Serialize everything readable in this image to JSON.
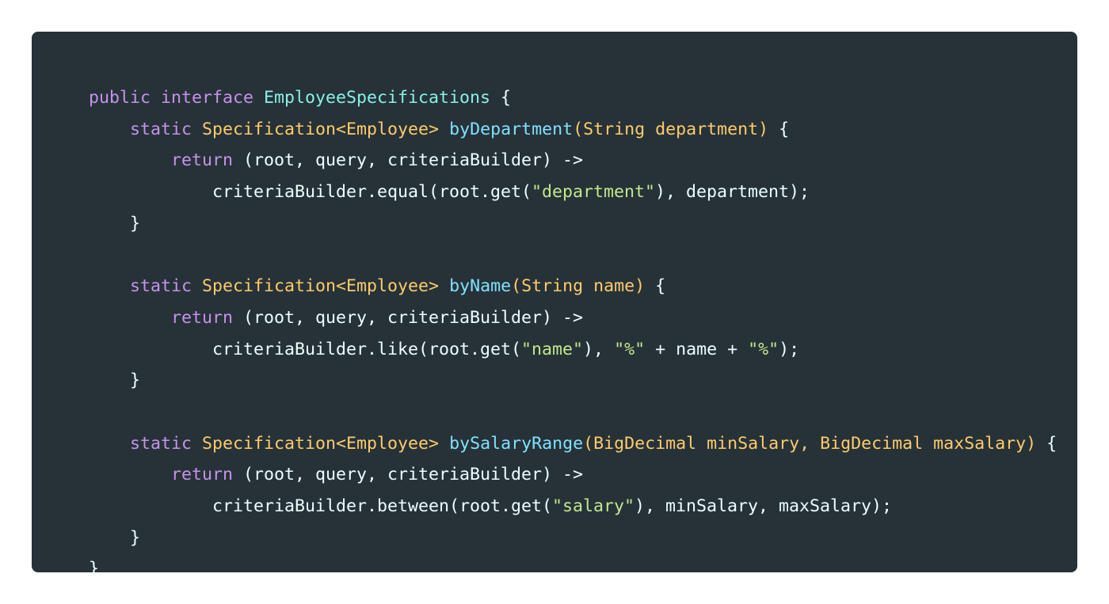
{
  "code": {
    "language": "java",
    "colors": {
      "background": "#263238",
      "keyword": "#c792ea",
      "type": "#ffcb6b",
      "function": "#82e0ff",
      "string": "#c3e88d",
      "plain": "#eeffff"
    },
    "lines": [
      [
        {
          "k": "keyword",
          "t": "public interface"
        },
        {
          "k": "plain",
          "t": " "
        },
        {
          "k": "iface",
          "t": "EmployeeSpecifications"
        },
        {
          "k": "plain",
          "t": " {"
        }
      ],
      [
        {
          "k": "plain",
          "t": "    "
        },
        {
          "k": "keyword",
          "t": "static"
        },
        {
          "k": "plain",
          "t": " "
        },
        {
          "k": "type",
          "t": "Specification<Employee>"
        },
        {
          "k": "plain",
          "t": " "
        },
        {
          "k": "fname",
          "t": "byDepartment"
        },
        {
          "k": "type",
          "t": "(String department)"
        },
        {
          "k": "plain",
          "t": " {"
        }
      ],
      [
        {
          "k": "plain",
          "t": "        "
        },
        {
          "k": "keyword",
          "t": "return"
        },
        {
          "k": "plain",
          "t": " (root, query, criteriaBuilder) ->"
        }
      ],
      [
        {
          "k": "plain",
          "t": "            criteriaBuilder.equal(root.get("
        },
        {
          "k": "string",
          "t": "\"department\""
        },
        {
          "k": "plain",
          "t": "), department);"
        }
      ],
      [
        {
          "k": "plain",
          "t": "    }"
        }
      ],
      [],
      [
        {
          "k": "plain",
          "t": "    "
        },
        {
          "k": "keyword",
          "t": "static"
        },
        {
          "k": "plain",
          "t": " "
        },
        {
          "k": "type",
          "t": "Specification<Employee>"
        },
        {
          "k": "plain",
          "t": " "
        },
        {
          "k": "fname",
          "t": "byName"
        },
        {
          "k": "type",
          "t": "(String name)"
        },
        {
          "k": "plain",
          "t": " {"
        }
      ],
      [
        {
          "k": "plain",
          "t": "        "
        },
        {
          "k": "keyword",
          "t": "return"
        },
        {
          "k": "plain",
          "t": " (root, query, criteriaBuilder) ->"
        }
      ],
      [
        {
          "k": "plain",
          "t": "            criteriaBuilder.like(root.get("
        },
        {
          "k": "string",
          "t": "\"name\""
        },
        {
          "k": "plain",
          "t": "), "
        },
        {
          "k": "string",
          "t": "\"%\""
        },
        {
          "k": "plain",
          "t": " + name + "
        },
        {
          "k": "string",
          "t": "\"%\""
        },
        {
          "k": "plain",
          "t": ");"
        }
      ],
      [
        {
          "k": "plain",
          "t": "    }"
        }
      ],
      [],
      [
        {
          "k": "plain",
          "t": "    "
        },
        {
          "k": "keyword",
          "t": "static"
        },
        {
          "k": "plain",
          "t": " "
        },
        {
          "k": "type",
          "t": "Specification<Employee>"
        },
        {
          "k": "plain",
          "t": " "
        },
        {
          "k": "fname",
          "t": "bySalaryRange"
        },
        {
          "k": "type",
          "t": "(BigDecimal minSalary, BigDecimal maxSalary)"
        },
        {
          "k": "plain",
          "t": " {"
        }
      ],
      [
        {
          "k": "plain",
          "t": "        "
        },
        {
          "k": "keyword",
          "t": "return"
        },
        {
          "k": "plain",
          "t": " (root, query, criteriaBuilder) ->"
        }
      ],
      [
        {
          "k": "plain",
          "t": "            criteriaBuilder.between(root.get("
        },
        {
          "k": "string",
          "t": "\"salary\""
        },
        {
          "k": "plain",
          "t": "), minSalary, maxSalary);"
        }
      ],
      [
        {
          "k": "plain",
          "t": "    }"
        }
      ],
      [
        {
          "k": "plain",
          "t": "}"
        }
      ]
    ]
  }
}
